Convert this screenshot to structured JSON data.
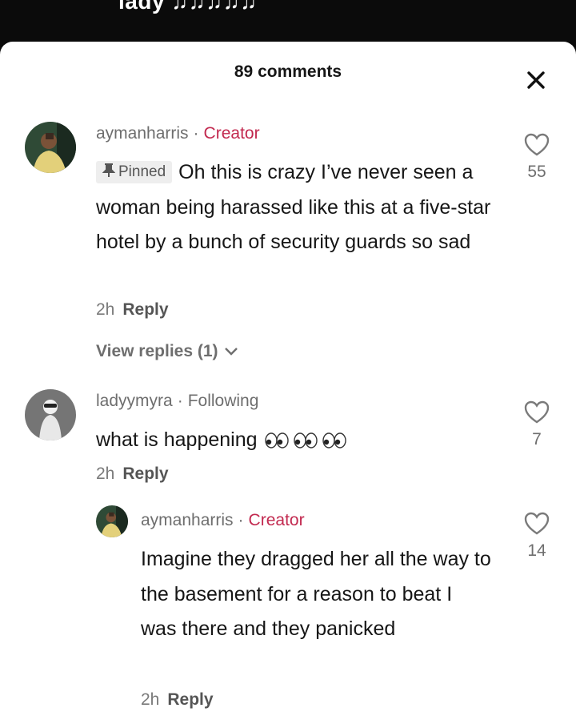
{
  "video": {
    "caption_fragment": "lady ♫♫♫♫♫"
  },
  "sheet": {
    "title": "89 comments",
    "close_icon": "close-icon"
  },
  "comments": [
    {
      "username": "aymanharris",
      "separator": "·",
      "role": "Creator",
      "pinned_label": "Pinned",
      "text": "Oh this is crazy I’ve never seen a woman being harassed like this at a five-star hotel by a bunch of security guards so sad",
      "time": "2h",
      "reply_label": "Reply",
      "likes": "55",
      "view_replies": "View replies (1)"
    },
    {
      "username": "ladyymyra",
      "separator": "·",
      "role": "Following",
      "text": "what is happening",
      "emoji": "eyes-emoji x3",
      "time": "2h",
      "reply_label": "Reply",
      "likes": "7",
      "replies": [
        {
          "username": "aymanharris",
          "separator": "·",
          "role": "Creator",
          "text": "Imagine they dragged her all the way to the basement for a reason to beat I was there and they panicked",
          "time": "2h",
          "reply_label": "Reply",
          "likes": "14"
        }
      ]
    }
  ],
  "colors": {
    "creator": "#c2294f",
    "muted": "#6e6e6e",
    "text": "#161616"
  }
}
